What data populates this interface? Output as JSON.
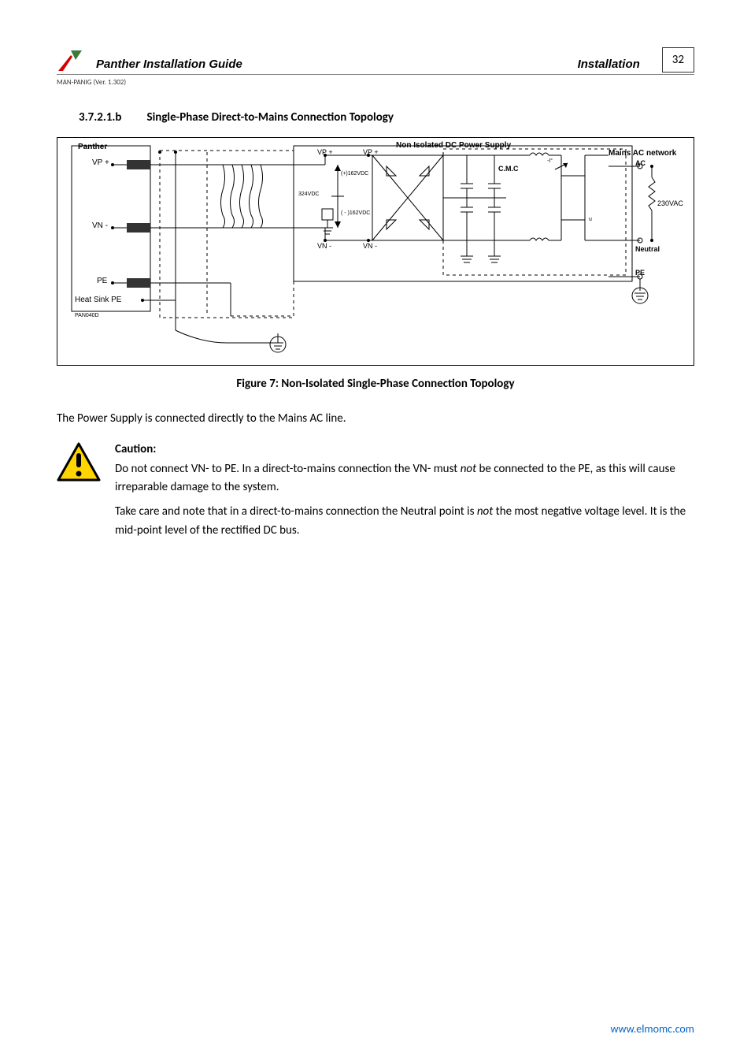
{
  "header": {
    "doc_title": "Panther Installation Guide",
    "section": "Installation",
    "page_number": "32",
    "doc_ref": "MAN-PANIG (Ver. 1.302)"
  },
  "section": {
    "number": "3.7.2.1.b",
    "title": "Single-Phase Direct-to-Mains Connection Topology"
  },
  "figure": {
    "caption": "Figure 7: Non-Isolated Single-Phase Connection Topology",
    "labels": {
      "panther": "Panther",
      "vp_plus": "VP +",
      "vn_minus": "VN -",
      "pe": "PE",
      "heat_sink_pe": "Heat Sink PE",
      "pan_ref": "PAN040D",
      "psu_title": "Non Isolated DC Power Supply",
      "vp_plus_a": "VP +",
      "vp_plus_b": "VP +",
      "v_plus_162": "(+)162VDC",
      "v_324": "324VDC",
      "v_minus_162": "( - )162VDC",
      "vn_minus_a": "VN -",
      "vn_minus_b": "VN -",
      "cmc": "C.M.C",
      "mains_title": "Mains AC network",
      "ac": "AC",
      "v_230": "230VAC",
      "neutral": "Neutral",
      "pe_right": "PE",
      "i_arrow": "-I°",
      "u": "u"
    }
  },
  "body": {
    "p1": "The Power Supply is connected directly to the Mains AC line."
  },
  "caution": {
    "title": "Caution:",
    "p1_a": "Do not connect VN- to PE. In a direct-to-mains connection the VN- must ",
    "p1_not": "not",
    "p1_b": " be connected to the PE, as this will cause irreparable damage to the system.",
    "p2_a": "Take care and note that in a direct-to-mains connection the Neutral point is ",
    "p2_not": "not",
    "p2_b": " the most negative voltage level. It is the mid-point level of the rectified DC bus."
  },
  "footer": {
    "url": "www.elmomc.com"
  }
}
